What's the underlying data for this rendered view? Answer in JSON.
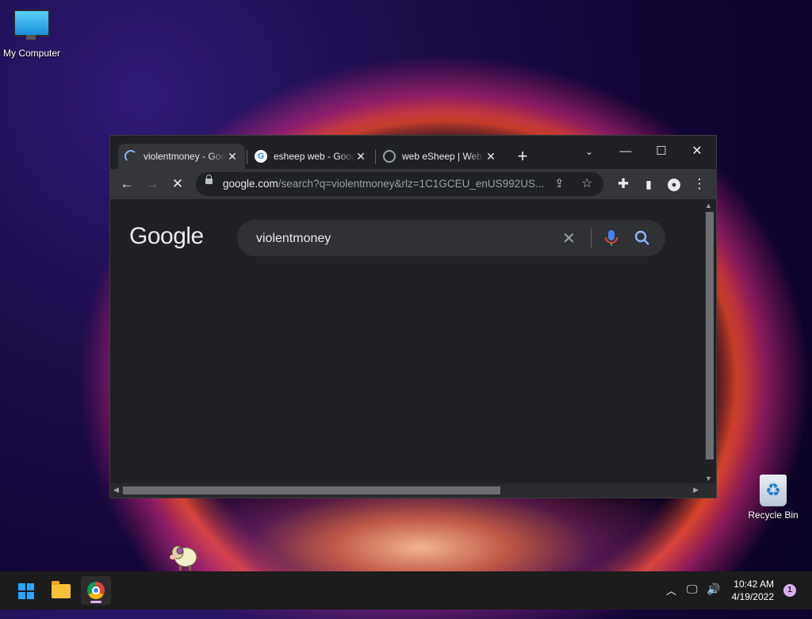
{
  "desktop": {
    "icons": [
      {
        "label": "My Computer",
        "icon": "computer-icon"
      },
      {
        "label": "Recycle Bin",
        "icon": "recycle-bin-icon"
      }
    ]
  },
  "browser": {
    "tabs": [
      {
        "title": "violentmoney - Google Search",
        "favicon": "loading-spinner",
        "active": true
      },
      {
        "title": "esheep web - Google Search",
        "favicon": "google-icon",
        "active": false
      },
      {
        "title": "web eSheep | Web",
        "favicon": "globe-icon",
        "active": false
      }
    ],
    "new_tab": "+",
    "address": {
      "host": "google.com",
      "path": "/search?q=violentmoney&rlz=1C1GCEU_enUS992US..."
    },
    "page": {
      "logo_text": "Google",
      "search_query": "violentmoney"
    }
  },
  "taskbar": {
    "apps": [
      "start-button",
      "file-explorer",
      "chrome"
    ],
    "clock_time": "10:42 AM",
    "clock_date": "4/19/2022",
    "notification_count": "1"
  },
  "colors": {
    "chrome_dark": "#202124",
    "toolbar": "#35363a",
    "accent": "#8ab4f8"
  }
}
